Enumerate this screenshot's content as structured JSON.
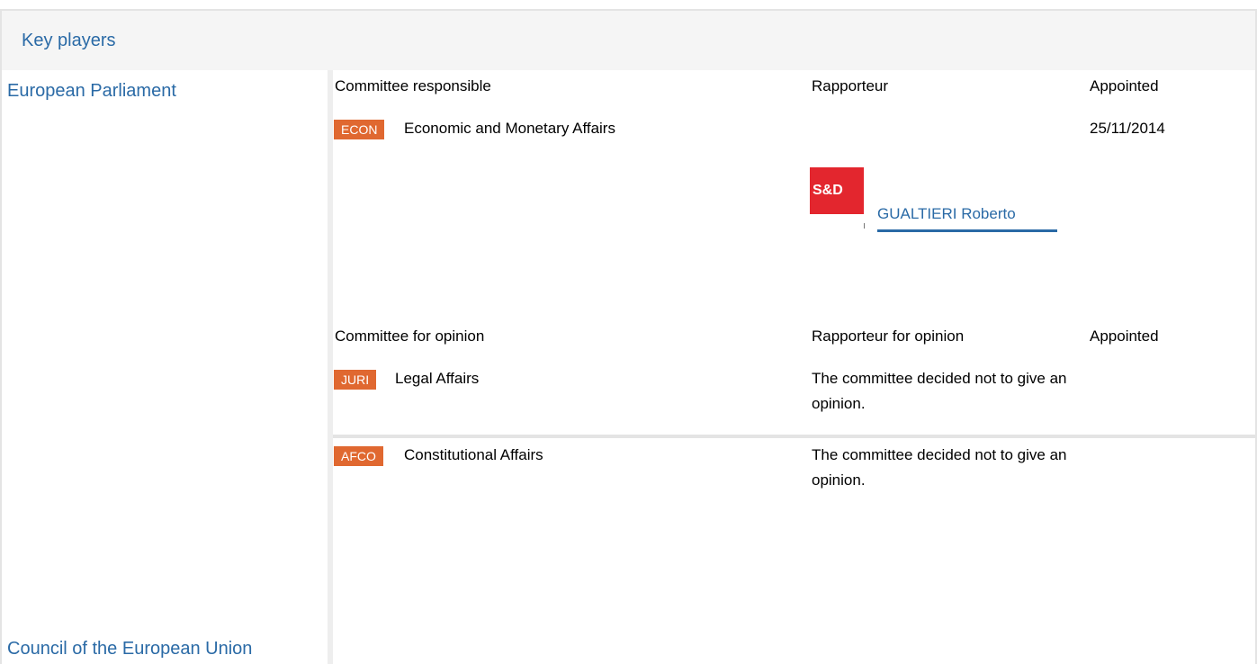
{
  "section": {
    "title": "Key players"
  },
  "institutions": {
    "parliament": "European Parliament",
    "council": "Council of the European Union"
  },
  "responsible": {
    "headers": {
      "committee": "Committee responsible",
      "rapporteur": "Rapporteur",
      "appointed": "Appointed"
    },
    "row": {
      "badge": "ECON",
      "name": "Economic and Monetary Affairs",
      "appointed": "25/11/2014",
      "group_logo_text": "S&D",
      "rapporteur_name": "GUALTIERI Roberto"
    }
  },
  "opinion": {
    "headers": {
      "committee": "Committee for opinion",
      "rapporteur": "Rapporteur for opinion",
      "appointed": "Appointed"
    },
    "rows": [
      {
        "badge": "JURI",
        "name": "Legal Affairs",
        "rapporteur_text": "The committee decided not to give an opinion."
      },
      {
        "badge": "AFCO",
        "name": "Constitutional Affairs",
        "rapporteur_text": "The committee decided not to give an opinion."
      }
    ]
  },
  "colors": {
    "link_blue": "#2a6aa6",
    "badge_orange": "#e06830",
    "sd_red": "#e3262e",
    "border_gray": "#e4e4e4",
    "header_bg": "#f5f5f5"
  }
}
